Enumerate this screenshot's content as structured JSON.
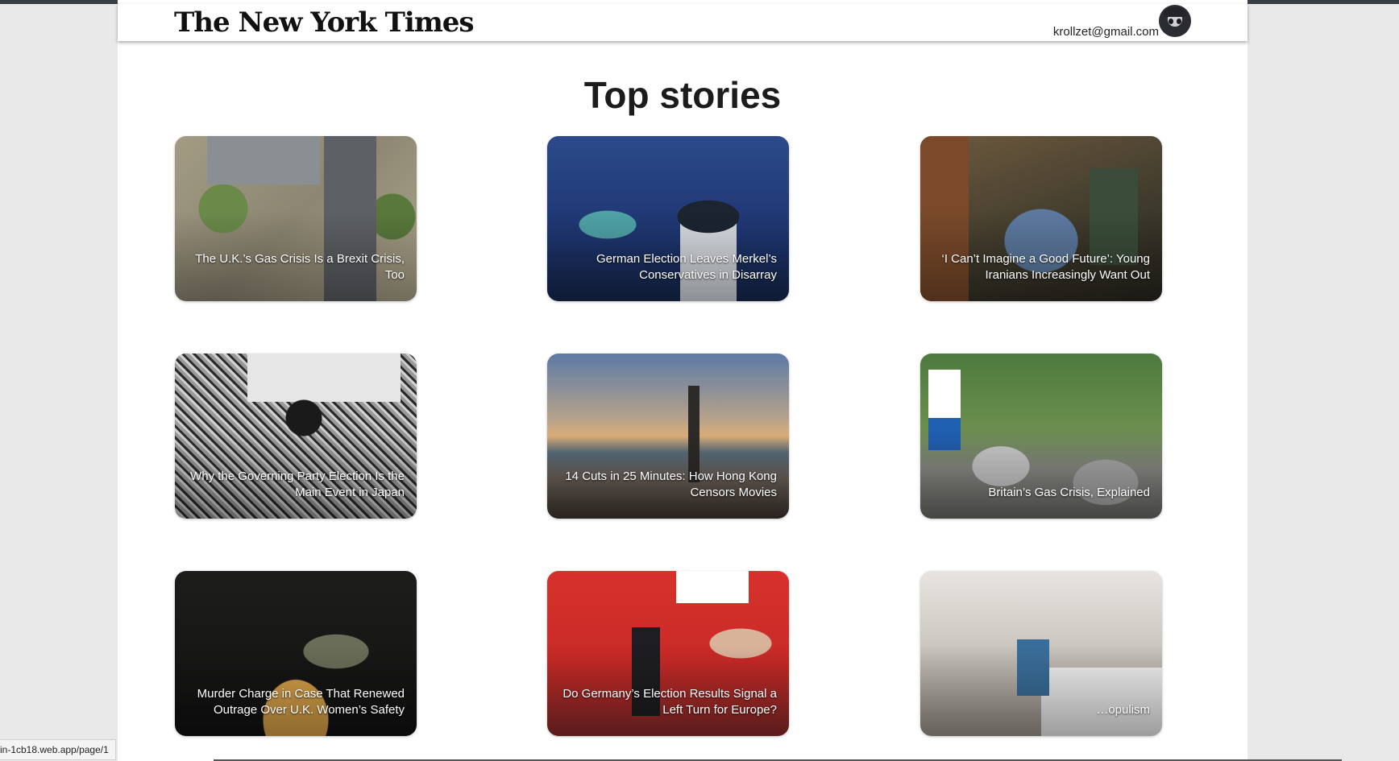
{
  "header": {
    "logo": "The New York Times",
    "user_email": "krollzet@gmail.com"
  },
  "main": {
    "title": "Top stories"
  },
  "stories": [
    {
      "headline": "The U.K.’s Gas Crisis Is a Brexit Crisis, Too"
    },
    {
      "headline": "German Election Leaves Merkel’s Conservatives in Disarray"
    },
    {
      "headline": "‘I Can’t Imagine a Good Future’: Young Iranians Increasingly Want Out"
    },
    {
      "headline": "Why the Governing Party Election Is the Main Event in Japan"
    },
    {
      "headline": "14 Cuts in 25 Minutes: How Hong Kong Censors Movies"
    },
    {
      "headline": "Britain’s Gas Crisis, Explained"
    },
    {
      "headline": "Murder Charge in Case That Renewed Outrage Over U.K. Women’s Safety"
    },
    {
      "headline": "Do Germany’s Election Results Signal a Left Turn for Europe?"
    },
    {
      "headline": "…opulism"
    }
  ],
  "status_bar": {
    "url": "in-1cb18.web.app/page/1"
  }
}
